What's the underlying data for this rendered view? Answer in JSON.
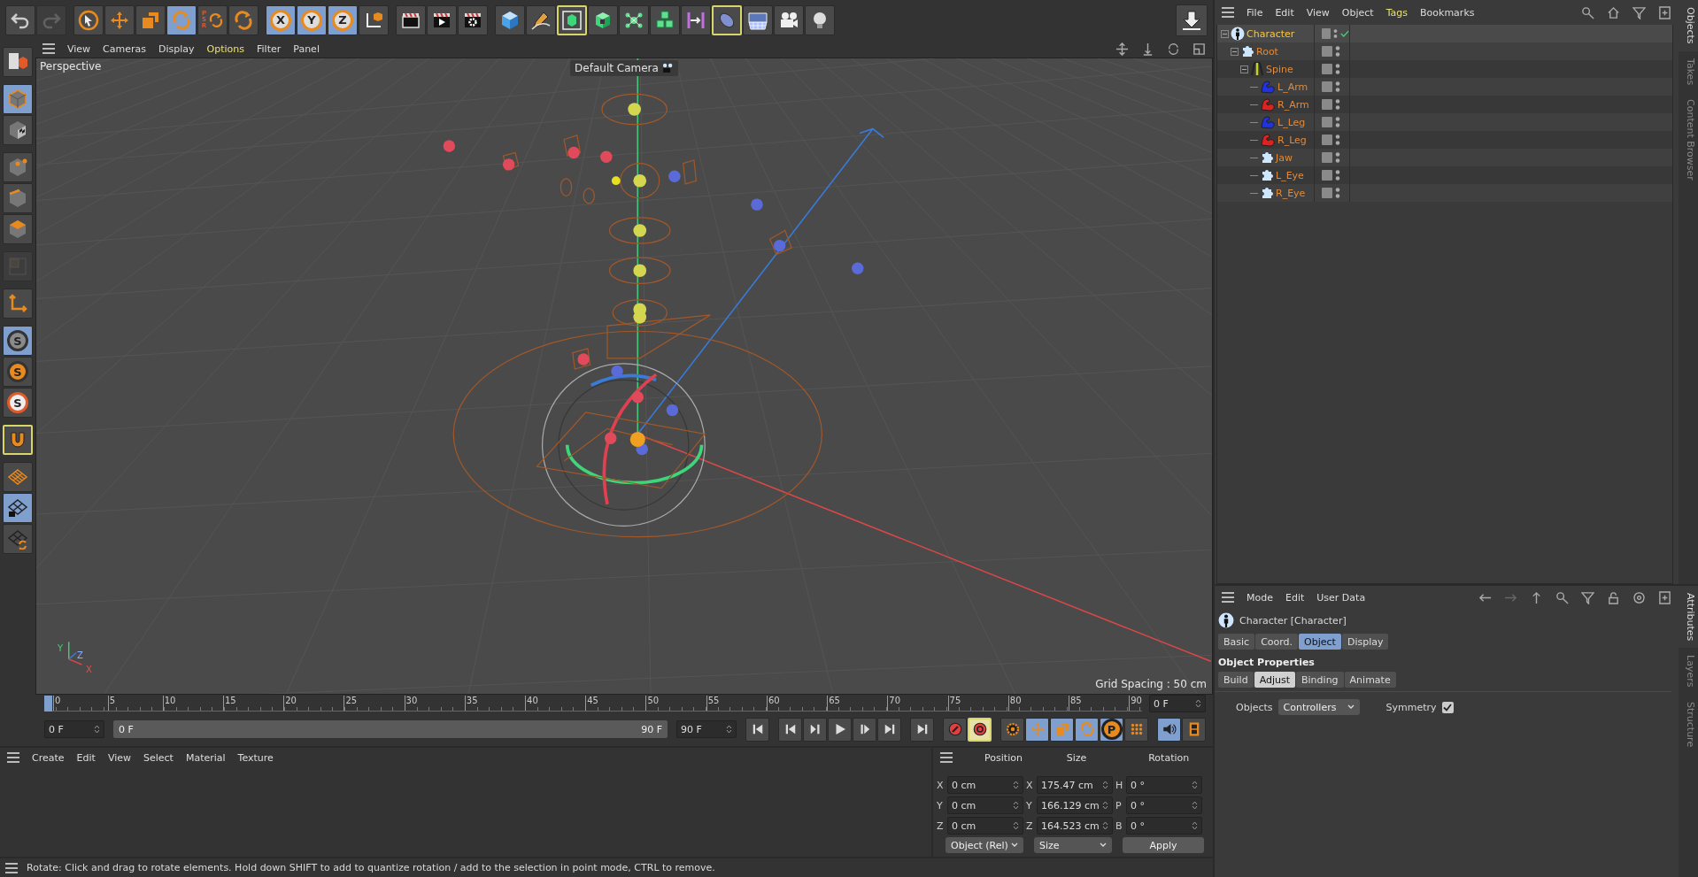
{
  "toolbar": {
    "groups": [
      [
        {
          "kind": "undo",
          "selected": false,
          "outlined": false,
          "disabled": false
        },
        {
          "kind": "redo",
          "selected": false,
          "outlined": false,
          "disabled": true
        }
      ],
      [
        {
          "kind": "select",
          "selected": false,
          "outlined": false,
          "disabled": false
        },
        {
          "kind": "move",
          "selected": false,
          "outlined": false,
          "disabled": false
        },
        {
          "kind": "scale",
          "selected": false,
          "outlined": false,
          "disabled": false
        },
        {
          "kind": "rotate",
          "selected": true,
          "outlined": false,
          "disabled": false
        },
        {
          "kind": "psr",
          "label": "PSR",
          "selected": false,
          "outlined": false,
          "disabled": false
        },
        {
          "kind": "rotate",
          "selected": false,
          "outlined": false,
          "disabled": false
        }
      ],
      [
        {
          "kind": "axis",
          "label": "X",
          "selected": true,
          "outlined": false,
          "disabled": false
        },
        {
          "kind": "axis",
          "label": "Y",
          "selected": true,
          "outlined": false,
          "disabled": false
        },
        {
          "kind": "axis",
          "label": "Z",
          "selected": true,
          "outlined": false,
          "disabled": false
        },
        {
          "kind": "coord-system",
          "selected": false,
          "outlined": false,
          "disabled": false
        }
      ],
      [
        {
          "kind": "clapper",
          "selected": false,
          "outlined": false,
          "disabled": false
        },
        {
          "kind": "clapper-play",
          "selected": false,
          "outlined": false,
          "disabled": false
        },
        {
          "kind": "clapper-gear",
          "selected": false,
          "outlined": false,
          "disabled": false
        }
      ],
      [
        {
          "kind": "cube",
          "selected": false,
          "outlined": false,
          "disabled": false
        },
        {
          "kind": "pen",
          "selected": false,
          "outlined": false,
          "disabled": false
        },
        {
          "kind": "framed-cube",
          "selected": false,
          "outlined": true,
          "disabled": false
        },
        {
          "kind": "solid-cube",
          "selected": false,
          "outlined": false,
          "disabled": false
        },
        {
          "kind": "molecule",
          "selected": false,
          "outlined": false,
          "disabled": false
        },
        {
          "kind": "cube-stack",
          "selected": false,
          "outlined": false,
          "disabled": false
        },
        {
          "kind": "bracket",
          "selected": false,
          "outlined": false,
          "disabled": false
        },
        {
          "kind": "disc",
          "selected": false,
          "outlined": true,
          "disabled": false
        },
        {
          "kind": "floor",
          "selected": false,
          "outlined": false,
          "disabled": false
        },
        {
          "kind": "camera",
          "selected": false,
          "outlined": false,
          "disabled": false
        },
        {
          "kind": "bulb",
          "selected": false,
          "outlined": false,
          "disabled": false
        }
      ]
    ],
    "right_button": {
      "kind": "download",
      "selected": false,
      "outlined": false,
      "disabled": false
    }
  },
  "left_tools": {
    "groups": [
      [
        {
          "kind": "layout-cube",
          "selected": false,
          "outlined": false,
          "disabled": false
        }
      ],
      [
        {
          "kind": "model-cube",
          "selected": true,
          "outlined": false,
          "disabled": false
        },
        {
          "kind": "texture-cube",
          "selected": false,
          "outlined": false,
          "disabled": false
        }
      ],
      [
        {
          "kind": "point-cube",
          "selected": false,
          "outlined": false,
          "disabled": false
        },
        {
          "kind": "edge-cube",
          "selected": false,
          "outlined": false,
          "disabled": false
        },
        {
          "kind": "polygon-cube",
          "selected": false,
          "outlined": false,
          "disabled": false
        }
      ],
      [
        {
          "kind": "panel-grid",
          "selected": false,
          "outlined": false,
          "disabled": true
        }
      ],
      [
        {
          "kind": "axis-corner",
          "selected": false,
          "outlined": false,
          "disabled": false
        }
      ],
      [
        {
          "kind": "snap",
          "label": "S",
          "selected": true,
          "outlined": false,
          "disabled": false
        },
        {
          "kind": "snap-filled",
          "label": "S",
          "selected": false,
          "outlined": false,
          "disabled": false
        },
        {
          "kind": "snap-ring",
          "label": "S",
          "selected": false,
          "outlined": false,
          "disabled": false
        }
      ],
      [
        {
          "kind": "magnet",
          "selected": false,
          "outlined": true,
          "disabled": false
        }
      ],
      [
        {
          "kind": "plane-grid",
          "selected": false,
          "outlined": false,
          "disabled": false
        },
        {
          "kind": "plane-lock",
          "selected": true,
          "outlined": false,
          "disabled": false
        },
        {
          "kind": "plane-sync",
          "selected": false,
          "outlined": false,
          "disabled": false
        }
      ]
    ]
  },
  "viewport": {
    "menu": [
      {
        "label": "View",
        "highlighted": false
      },
      {
        "label": "Cameras",
        "highlighted": false
      },
      {
        "label": "Display",
        "highlighted": false
      },
      {
        "label": "Options",
        "highlighted": true
      },
      {
        "label": "Filter",
        "highlighted": false
      },
      {
        "label": "Panel",
        "highlighted": false
      }
    ],
    "view_name": "Perspective",
    "camera": "Default Camera",
    "grid_spacing": "Grid Spacing : 50 cm",
    "gizmo_labels": [
      "Y",
      "Z",
      "X"
    ]
  },
  "timeline": {
    "ticks": [
      "0",
      "5",
      "10",
      "15",
      "20",
      "25",
      "30",
      "35",
      "40",
      "45",
      "50",
      "55",
      "60",
      "65",
      "70",
      "75",
      "80",
      "85",
      "90"
    ],
    "current": "0 F",
    "start": "0 F",
    "range_start": "0 F",
    "range_end": "90 F",
    "range_bar": {
      "level": 1
    },
    "end": "90 F",
    "transport": [
      [
        {
          "kind": "to-start",
          "selected": false,
          "outlined": false,
          "disabled": false
        }
      ],
      [
        {
          "kind": "to-start",
          "selected": false,
          "outlined": false,
          "disabled": false
        },
        {
          "kind": "prev-frame",
          "selected": false,
          "outlined": false,
          "disabled": false
        },
        {
          "kind": "play",
          "selected": false,
          "outlined": false,
          "disabled": false
        },
        {
          "kind": "next-frame",
          "selected": false,
          "outlined": false,
          "disabled": false
        },
        {
          "kind": "to-end",
          "selected": false,
          "outlined": false,
          "disabled": false
        }
      ],
      [
        {
          "kind": "to-end",
          "selected": false,
          "outlined": false,
          "disabled": false
        }
      ],
      [
        {
          "kind": "record",
          "selected": false,
          "outlined": false,
          "disabled": false
        },
        {
          "kind": "autokey",
          "selected": false,
          "outlined": true,
          "disabled": false
        }
      ],
      [
        {
          "kind": "key-gear",
          "selected": false,
          "outlined": false,
          "disabled": false
        },
        {
          "kind": "move",
          "selected": true,
          "outlined": false,
          "disabled": false
        },
        {
          "kind": "scale",
          "selected": true,
          "outlined": false,
          "disabled": false
        },
        {
          "kind": "rotate",
          "selected": true,
          "outlined": false,
          "disabled": false
        },
        {
          "kind": "param",
          "label": "P",
          "selected": true,
          "outlined": false,
          "disabled": false
        },
        {
          "kind": "dot-grid",
          "selected": false,
          "outlined": false,
          "disabled": false
        }
      ],
      [
        {
          "kind": "speaker",
          "selected": true,
          "outlined": false,
          "disabled": false
        },
        {
          "kind": "film",
          "selected": false,
          "outlined": false,
          "disabled": false
        }
      ]
    ]
  },
  "material_manager": {
    "menu": [
      "Create",
      "Edit",
      "View",
      "Select",
      "Material",
      "Texture"
    ]
  },
  "coordinates": {
    "headers": [
      "Position",
      "Size",
      "Rotation"
    ],
    "rows": [
      {
        "axis": "X",
        "position": "0 cm",
        "size_axis": "X",
        "size": "175.47 cm",
        "rot_axis": "H",
        "rotation": "0 °"
      },
      {
        "axis": "Y",
        "position": "0 cm",
        "size_axis": "Y",
        "size": "166.129 cm",
        "rot_axis": "P",
        "rotation": "0 °"
      },
      {
        "axis": "Z",
        "position": "0 cm",
        "size_axis": "Z",
        "size": "164.523 cm",
        "rot_axis": "B",
        "rotation": "0 °"
      }
    ],
    "mode": "Object (Rel)",
    "size_mode": "Size",
    "apply": "Apply"
  },
  "status_bar": "Rotate: Click and drag to rotate elements. Hold down SHIFT to add to quantize rotation / add to the selection in point mode, CTRL to remove.",
  "objects": {
    "menu": [
      {
        "label": "File",
        "highlighted": false
      },
      {
        "label": "Edit",
        "highlighted": false
      },
      {
        "label": "View",
        "highlighted": false
      },
      {
        "label": "Object",
        "highlighted": false
      },
      {
        "label": "Tags",
        "highlighted": true
      },
      {
        "label": "Bookmarks",
        "highlighted": false
      }
    ],
    "tree": [
      {
        "name": "Character",
        "kind": "character",
        "selected": true,
        "expanded": true,
        "tags": [
          {
            "kind": "check"
          }
        ],
        "children": [
          {
            "name": "Root",
            "kind": "puzzle",
            "selected": false,
            "expanded": true,
            "children": [
              {
                "name": "Spine",
                "kind": "spine",
                "selected": false,
                "expanded": true,
                "children": [
                  {
                    "name": "L_Arm",
                    "kind": "arm",
                    "color": "#2233dd",
                    "selected": false
                  },
                  {
                    "name": "R_Arm",
                    "kind": "arm",
                    "color": "#dd2222",
                    "selected": false
                  },
                  {
                    "name": "L_Leg",
                    "kind": "arm",
                    "color": "#2233dd",
                    "selected": false
                  },
                  {
                    "name": "R_Leg",
                    "kind": "arm",
                    "color": "#dd2222",
                    "selected": false
                  },
                  {
                    "name": "Jaw",
                    "kind": "puzzle",
                    "selected": false
                  },
                  {
                    "name": "L_Eye",
                    "kind": "puzzle",
                    "selected": false
                  },
                  {
                    "name": "R_Eye",
                    "kind": "puzzle",
                    "selected": false
                  }
                ]
              }
            ]
          }
        ]
      }
    ]
  },
  "side_tabs_top": [
    {
      "label": "Objects",
      "selected": true
    },
    {
      "label": "Takes",
      "selected": false
    },
    {
      "label": "Content Browser",
      "selected": false
    }
  ],
  "attributes": {
    "menu": [
      "Mode",
      "Edit",
      "User Data"
    ],
    "title": "Character [Character]",
    "tabs": [
      {
        "label": "Basic",
        "selected": false
      },
      {
        "label": "Coord.",
        "selected": false
      },
      {
        "label": "Object",
        "selected": true
      },
      {
        "label": "Display",
        "selected": false
      }
    ],
    "section": "Object Properties",
    "subtabs": [
      {
        "label": "Build",
        "selected": false
      },
      {
        "label": "Adjust",
        "selected": true
      },
      {
        "label": "Binding",
        "selected": false
      },
      {
        "label": "Animate",
        "selected": false
      }
    ],
    "objects_label": "Objects",
    "objects_value": "Controllers",
    "symmetry_label": "Symmetry",
    "symmetry": true
  },
  "side_tabs_bottom": [
    {
      "label": "Attributes",
      "selected": true
    },
    {
      "label": "Layers",
      "selected": false
    },
    {
      "label": "Structure",
      "selected": false
    }
  ]
}
